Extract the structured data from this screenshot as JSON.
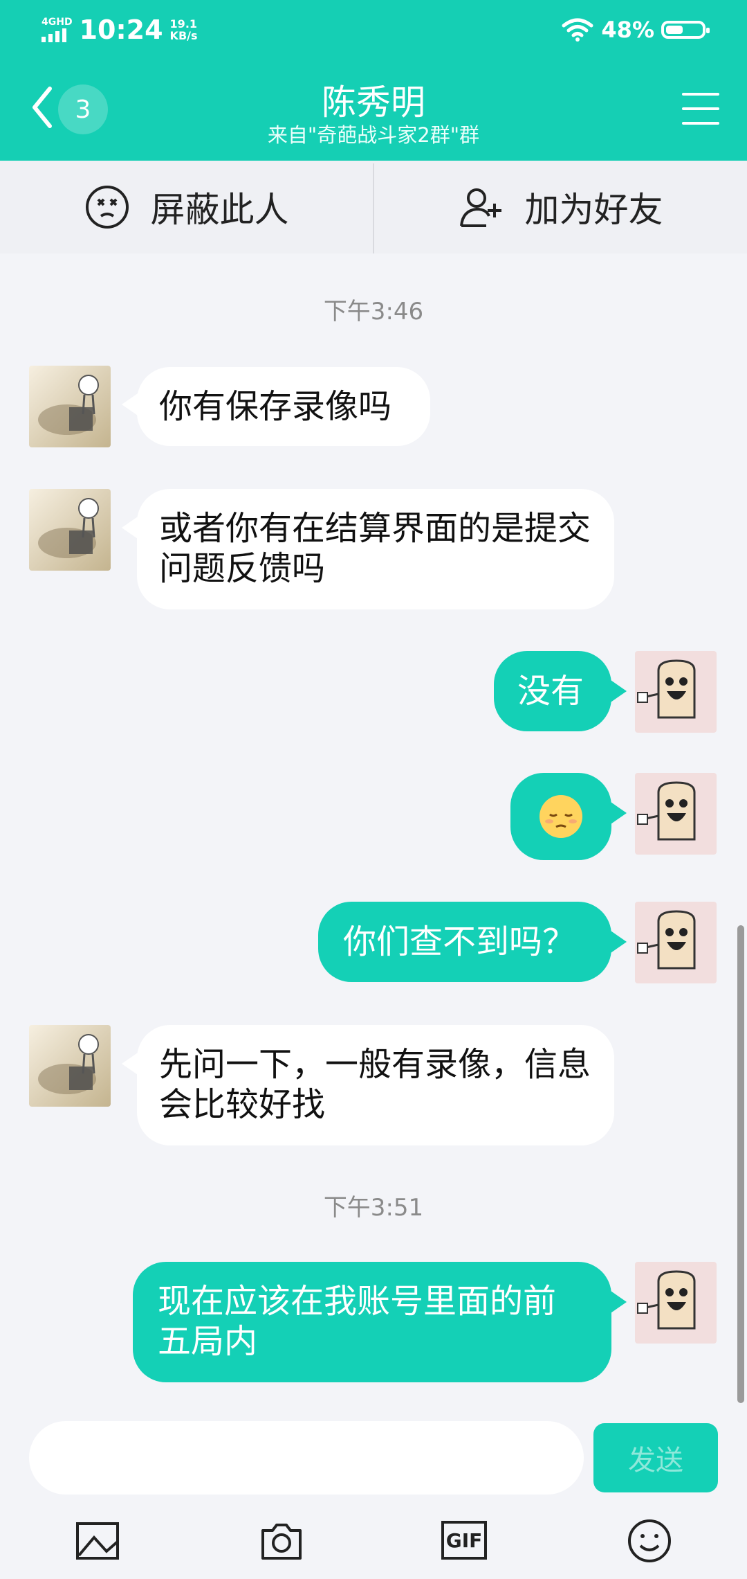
{
  "status_bar": {
    "network": "4GHD",
    "time": "10:24",
    "speed_value": "19.1",
    "speed_unit": "KB/s",
    "battery": "48%",
    "battery_level": 0.48
  },
  "header": {
    "unread_count": "3",
    "title": "陈秀明",
    "subtitle": "来自\"奇葩战斗家2群\"群"
  },
  "actions": {
    "block_label": "屏蔽此人",
    "add_friend_label": "加为好友"
  },
  "chat": {
    "timestamps": [
      "下午3:46",
      "下午3:51"
    ],
    "messages": [
      {
        "from": "them",
        "text": "你有保存录像吗"
      },
      {
        "from": "them",
        "text": "或者你有在结算界面的是提交问题反馈吗"
      },
      {
        "from": "me",
        "text": "没有"
      },
      {
        "from": "me",
        "emoji": "😔"
      },
      {
        "from": "me",
        "text": "你们查不到吗？"
      },
      {
        "from": "them",
        "text": "先问一下，一般有录像，信息会比较好找"
      },
      {
        "from": "me",
        "text": "现在应该在我账号里面的前五局内"
      }
    ]
  },
  "input": {
    "value": "",
    "send_label": "发送"
  },
  "toolbar": {
    "icons": [
      "image-icon",
      "camera-icon",
      "gif-icon",
      "emoji-icon"
    ],
    "gif_label": "GIF"
  },
  "colors": {
    "accent": "#15cfb4",
    "background": "#f3f4f8",
    "bubble_them": "#ffffff",
    "bubble_me": "#14d0b6"
  }
}
